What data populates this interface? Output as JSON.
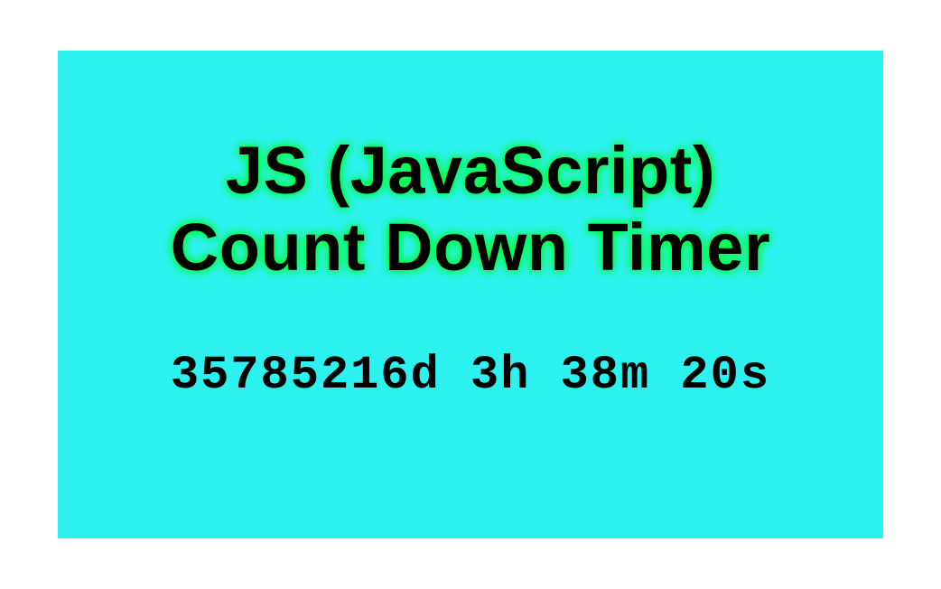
{
  "title": {
    "line1": "JS (JavaScript)",
    "line2": "Count Down Timer"
  },
  "countdown": {
    "days": "35785216",
    "hours": "3",
    "minutes": "38",
    "seconds": "20",
    "display": "35785216d 3h 38m 20s"
  }
}
